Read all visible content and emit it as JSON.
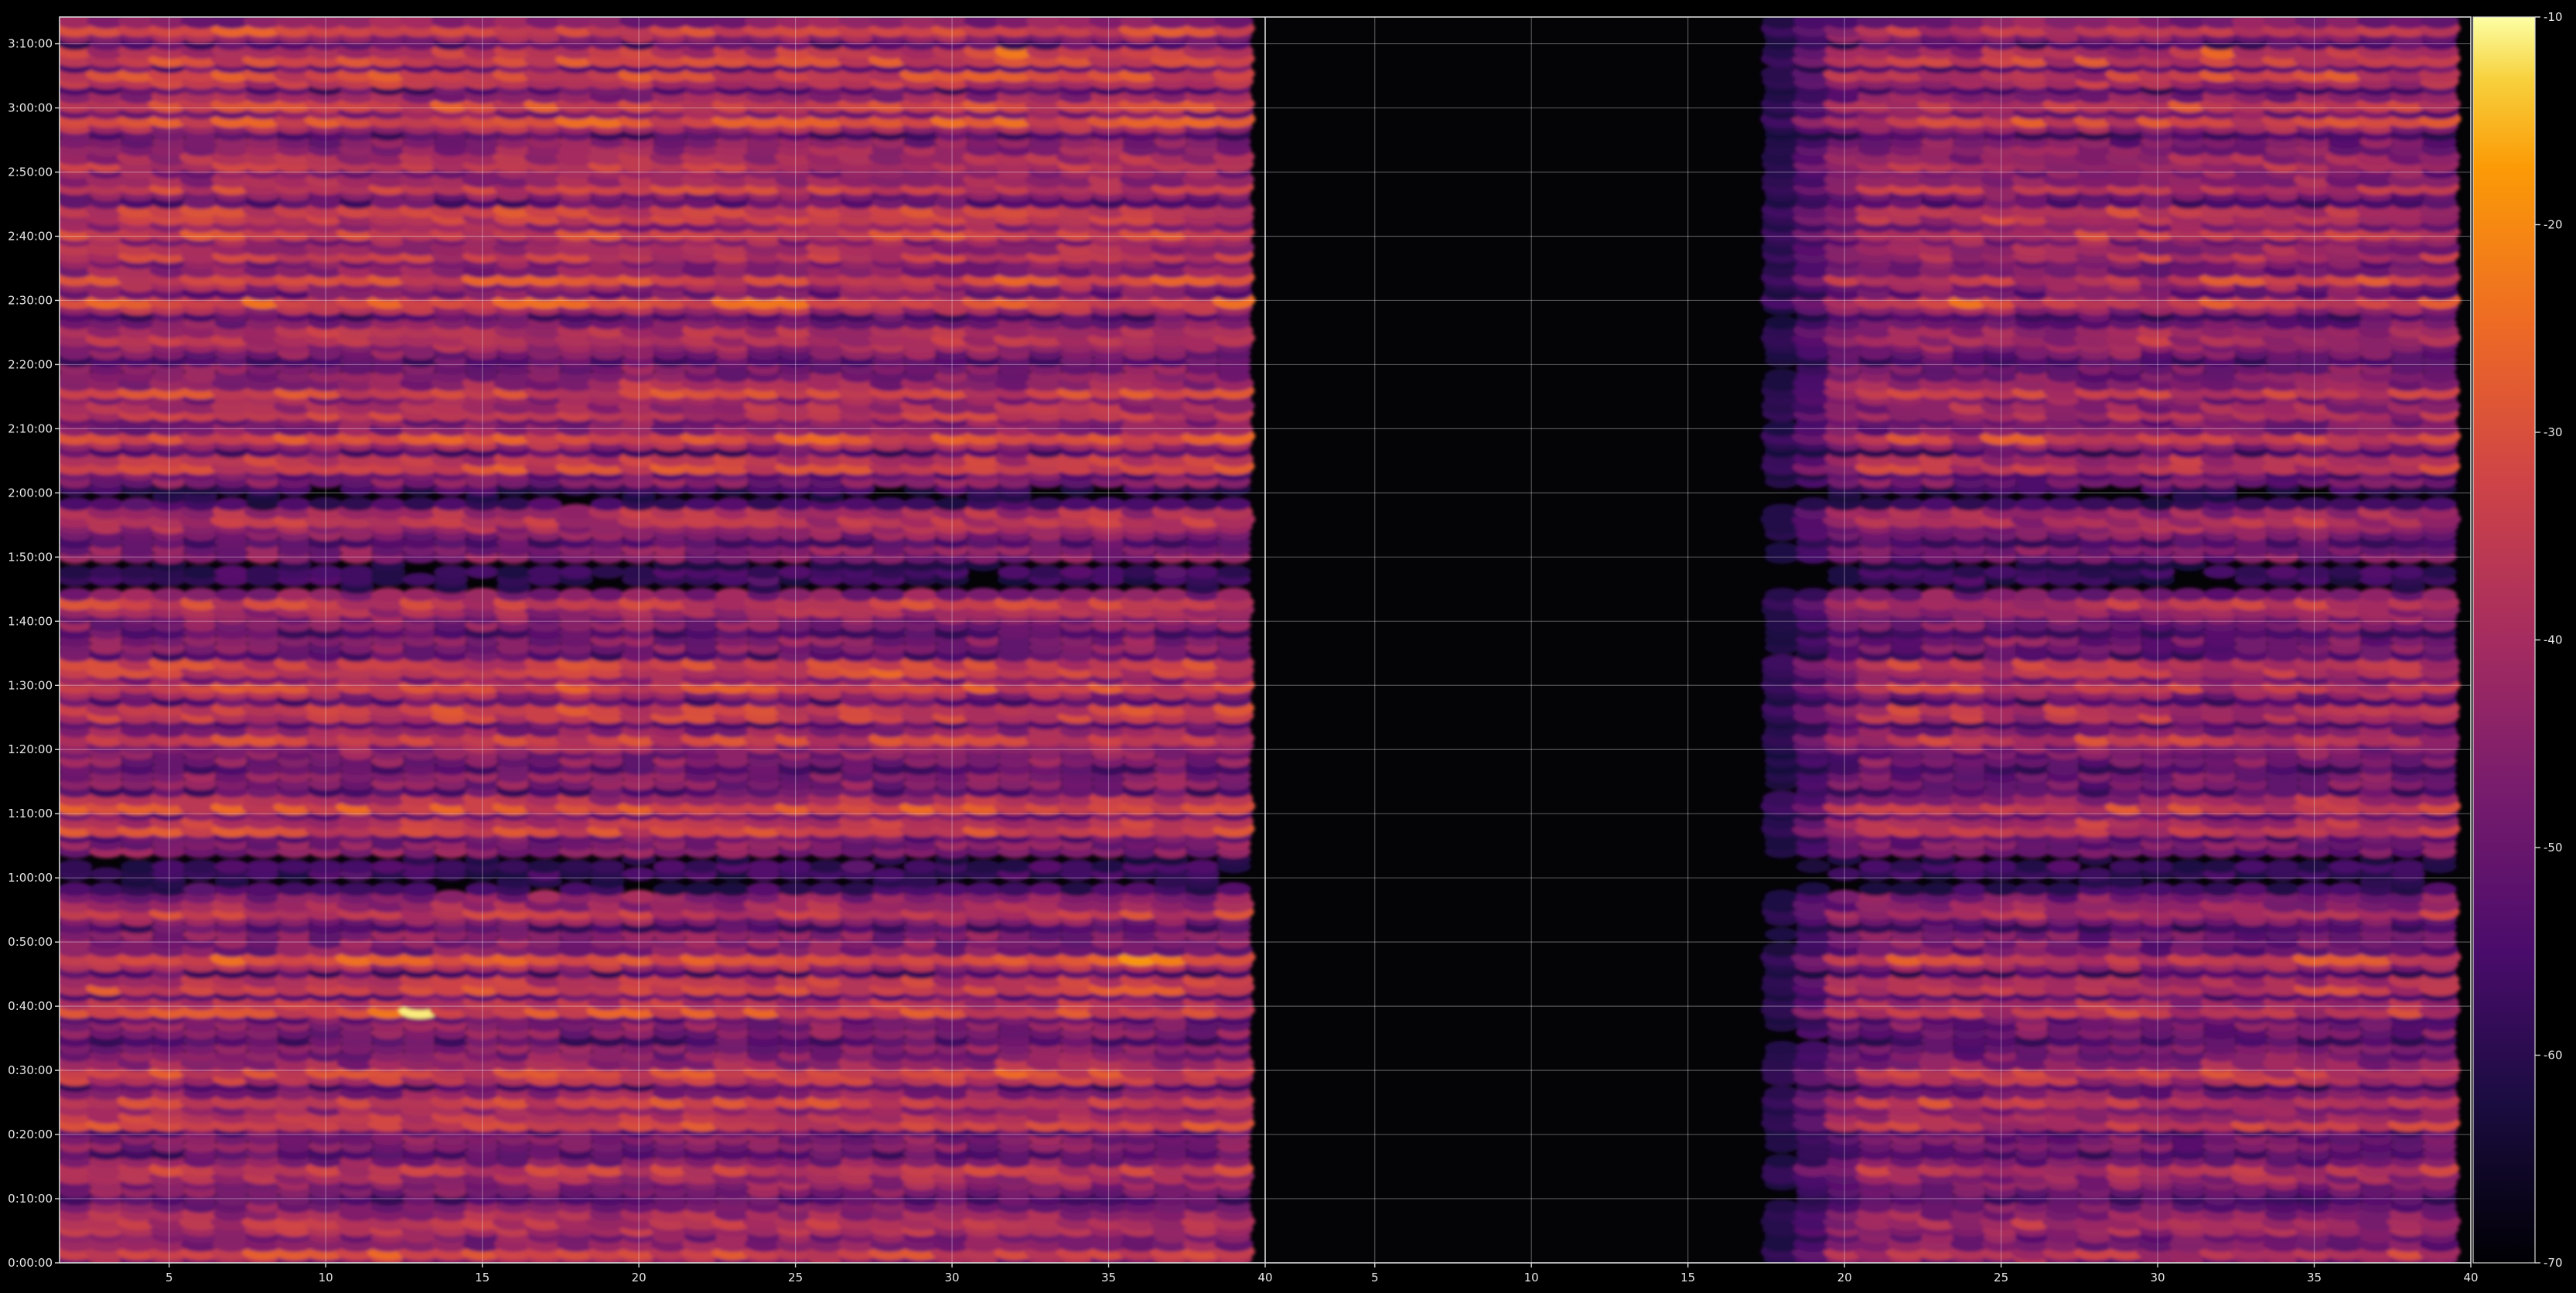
{
  "chart_data": {
    "type": "heatmap",
    "title": "",
    "xlabel": "",
    "ylabel": "",
    "colormap": "inferno",
    "background": "#000000",
    "grid": true,
    "panels": [
      {
        "name": "",
        "xlim": [
          1.5,
          40
        ],
        "xticks": [
          5,
          10,
          15,
          20,
          25,
          30,
          35,
          40
        ]
      },
      {
        "name": "",
        "xlim": [
          1.5,
          40
        ],
        "xticks": [
          5,
          10,
          15,
          20,
          25,
          30,
          35,
          40
        ],
        "data_starts_at": 17
      }
    ],
    "ylim_seconds": [
      0,
      11650
    ],
    "yticks": [
      {
        "label": "0:00:00",
        "seconds": 0
      },
      {
        "label": "0:10:00",
        "seconds": 600
      },
      {
        "label": "0:20:00",
        "seconds": 1200
      },
      {
        "label": "0:30:00",
        "seconds": 1800
      },
      {
        "label": "0:40:00",
        "seconds": 2400
      },
      {
        "label": "0:50:00",
        "seconds": 3000
      },
      {
        "label": "1:00:00",
        "seconds": 3600
      },
      {
        "label": "1:10:00",
        "seconds": 4200
      },
      {
        "label": "1:20:00",
        "seconds": 4800
      },
      {
        "label": "1:30:00",
        "seconds": 5400
      },
      {
        "label": "1:40:00",
        "seconds": 6000
      },
      {
        "label": "1:50:00",
        "seconds": 6600
      },
      {
        "label": "2:00:00",
        "seconds": 7200
      },
      {
        "label": "2:10:00",
        "seconds": 7800
      },
      {
        "label": "2:20:00",
        "seconds": 8400
      },
      {
        "label": "2:30:00",
        "seconds": 9000
      },
      {
        "label": "2:40:00",
        "seconds": 9600
      },
      {
        "label": "2:50:00",
        "seconds": 10200
      },
      {
        "label": "3:00:00",
        "seconds": 10800
      },
      {
        "label": "3:10:00",
        "seconds": 11400
      }
    ],
    "colorbar": {
      "range": [
        -70,
        -10
      ],
      "ticks": [
        -10,
        -20,
        -30,
        -40,
        -50,
        -60,
        -70
      ]
    },
    "bright_rows_seconds": [
      120,
      380,
      840,
      1330,
      1490,
      1780,
      1830,
      2380,
      2600,
      2860,
      3320,
      4080,
      4280,
      4880,
      5160,
      5420,
      5580,
      6140,
      6960,
      7470,
      7740,
      7990,
      8180,
      8660,
      9000,
      9230,
      9470,
      9660,
      9820,
      10100,
      10320,
      10700,
      10820,
      11100,
      11280,
      11560
    ],
    "bright_spots": [
      {
        "x": 12,
        "t": 60
      },
      {
        "x": 32,
        "t": 1820
      },
      {
        "x": 13,
        "t": 2360
      },
      {
        "x": 36.5,
        "t": 2820
      },
      {
        "x": 28,
        "t": 5560
      },
      {
        "x": 20.5,
        "t": 8220
      },
      {
        "x": 25,
        "t": 9030
      },
      {
        "x": 32,
        "t": 11330
      }
    ]
  }
}
